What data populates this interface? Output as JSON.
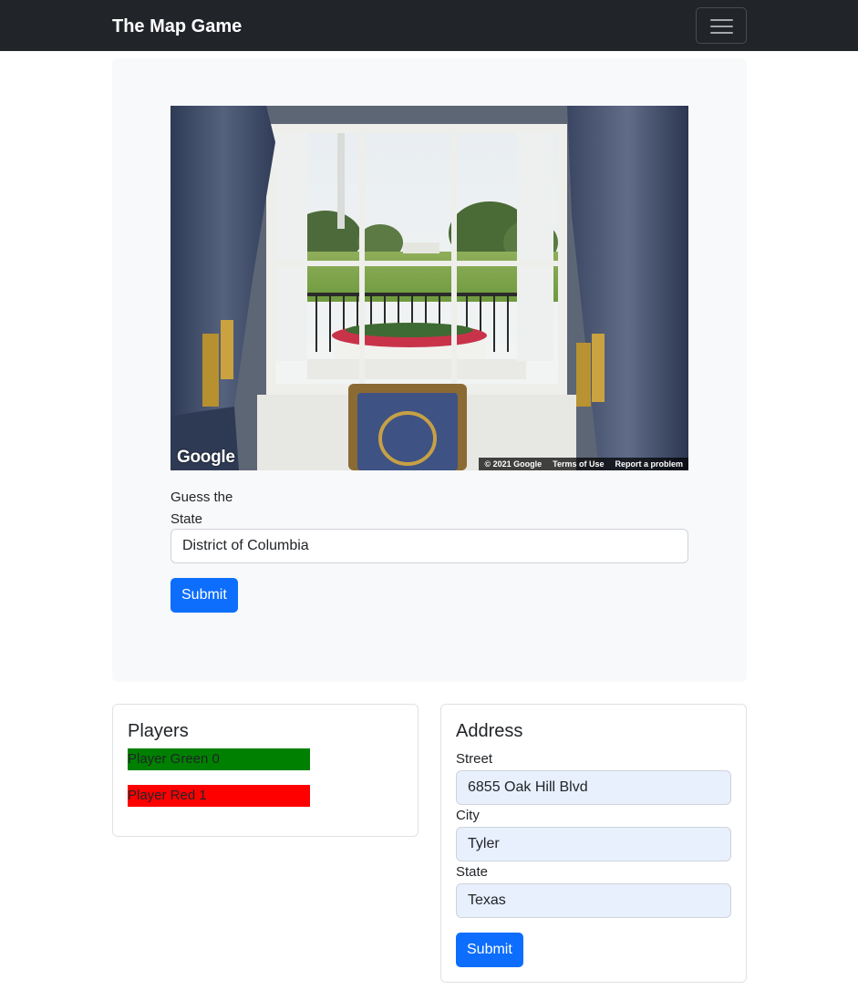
{
  "navbar": {
    "brand": "The Map Game",
    "toggler_icon": "hamburger-icon"
  },
  "street_view": {
    "logo": "Google",
    "attribution": {
      "copyright": "© 2021 Google",
      "terms": "Terms of Use",
      "report": "Report a problem"
    }
  },
  "guess": {
    "label": "Guess the State",
    "value": "District of Columbia",
    "submit_label": "Submit"
  },
  "players": {
    "title": "Players",
    "items": [
      {
        "label": "Player Green 0",
        "color": "#008000"
      },
      {
        "label": "Player Red 1",
        "color": "#ff0000"
      }
    ]
  },
  "address": {
    "title": "Address",
    "street_label": "Street",
    "street_value": "6855 Oak Hill Blvd",
    "city_label": "City",
    "city_value": "Tyler",
    "state_label": "State",
    "state_value": "Texas",
    "submit_label": "Submit"
  },
  "colors": {
    "navbar_bg": "#212529",
    "primary": "#0d6efd",
    "panel_bg": "#f8f9fa",
    "autofill_bg": "#e8f0fe"
  }
}
